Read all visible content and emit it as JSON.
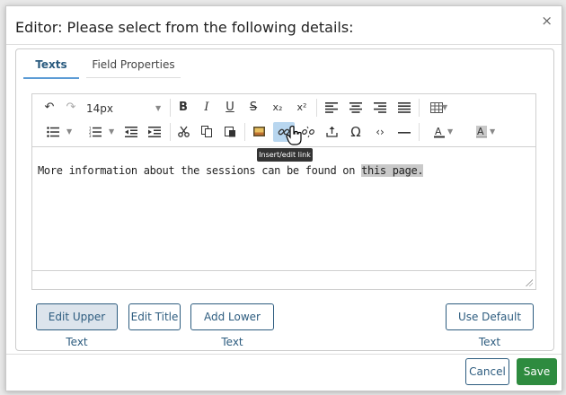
{
  "dialog": {
    "title": "Editor: Please select from the following details:",
    "close": "×"
  },
  "tabs": [
    {
      "label": "Texts",
      "active": true
    },
    {
      "label": "Field Properties",
      "active": false
    }
  ],
  "toolbar": {
    "font_size": "14px",
    "icons": {
      "undo": "↶",
      "redo": "↷",
      "bold": "B",
      "italic": "I",
      "underline": "U",
      "strike": "S",
      "sub": "x₂",
      "sup": "x²",
      "omega": "Ω",
      "code": "‹›"
    }
  },
  "editor": {
    "text_before": "More information about the sessions can be found on ",
    "link_text": "this page."
  },
  "tooltip": "Insert/edit link",
  "buttons": {
    "edit_upper": "Edit Upper Text",
    "edit_title": "Edit Title",
    "add_lower": "Add Lower Text",
    "use_default": "Use Default Text",
    "cancel": "Cancel",
    "save": "Save"
  },
  "colors": {
    "accent": "#2d5c7f",
    "save_green": "#2e8b3f",
    "highlight": "#b8d6ef"
  }
}
